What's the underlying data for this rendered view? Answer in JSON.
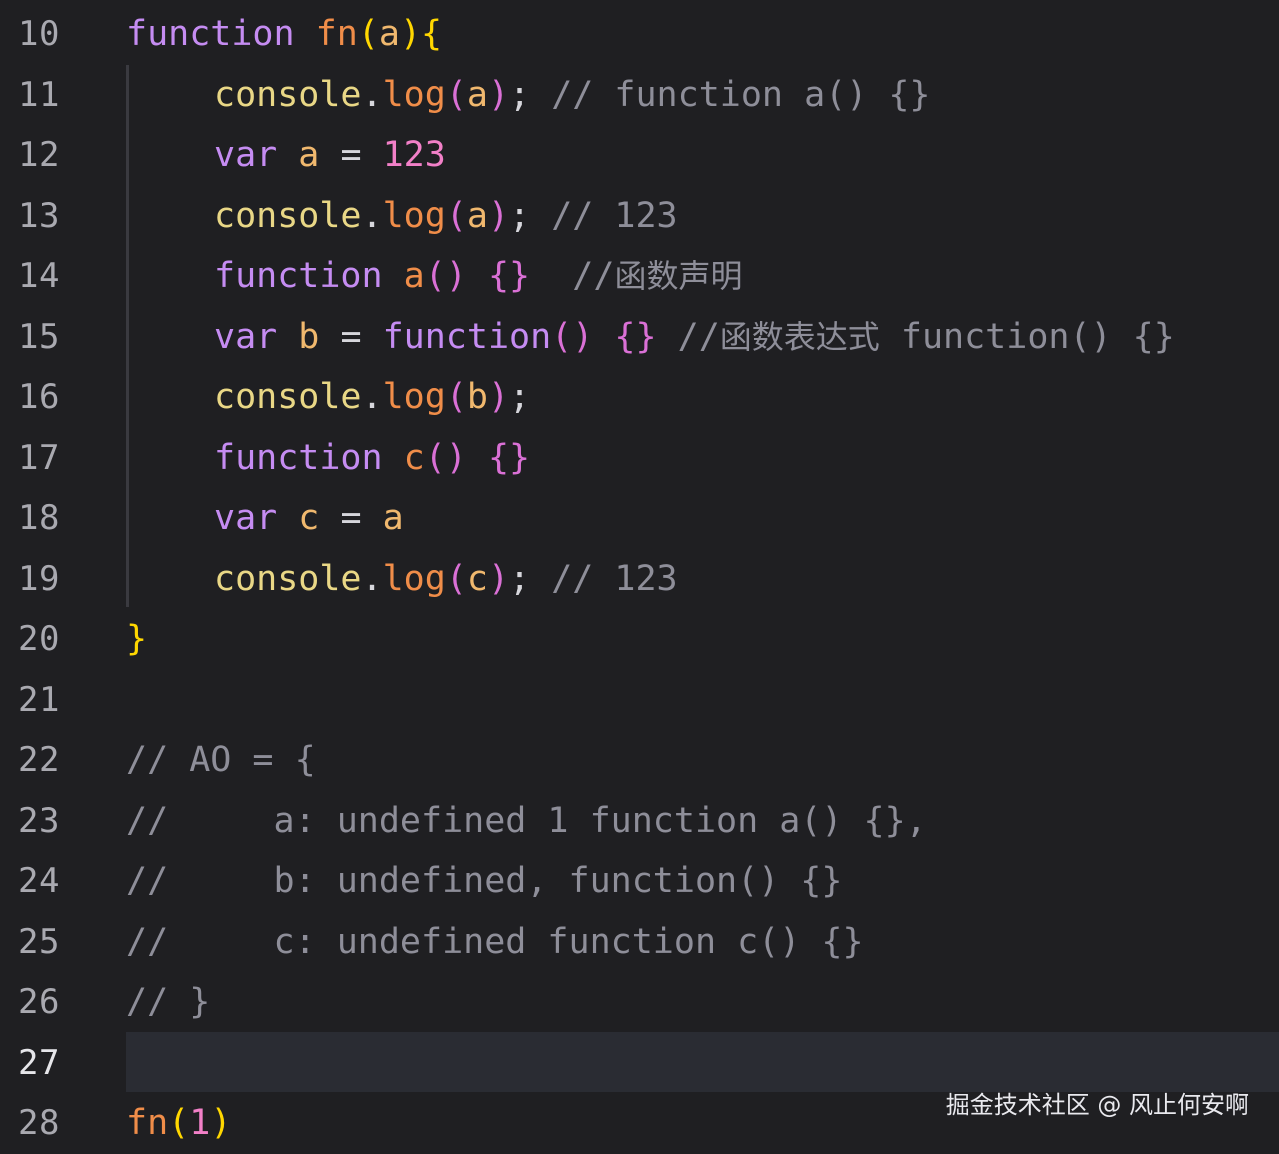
{
  "editor": {
    "lines": [
      {
        "n": "10",
        "parts": [
          [
            "kw",
            "function"
          ],
          [
            "plain",
            " "
          ],
          [
            "fn",
            "fn"
          ],
          [
            "punc-y",
            "("
          ],
          [
            "ident",
            "a"
          ],
          [
            "punc-y",
            ")"
          ],
          [
            "punc-y",
            "{"
          ]
        ]
      },
      {
        "n": "11",
        "indent": 1,
        "parts": [
          [
            "call",
            "console"
          ],
          [
            "op",
            "."
          ],
          [
            "fn",
            "log"
          ],
          [
            "punc-p",
            "("
          ],
          [
            "ident",
            "a"
          ],
          [
            "punc-p",
            ")"
          ],
          [
            "op",
            "; "
          ],
          [
            "cmt",
            "// function a() {}"
          ]
        ]
      },
      {
        "n": "12",
        "indent": 1,
        "parts": [
          [
            "kw",
            "var"
          ],
          [
            "plain",
            " "
          ],
          [
            "ident",
            "a"
          ],
          [
            "op",
            " = "
          ],
          [
            "num",
            "123"
          ]
        ]
      },
      {
        "n": "13",
        "indent": 1,
        "parts": [
          [
            "call",
            "console"
          ],
          [
            "op",
            "."
          ],
          [
            "fn",
            "log"
          ],
          [
            "punc-p",
            "("
          ],
          [
            "ident",
            "a"
          ],
          [
            "punc-p",
            ")"
          ],
          [
            "op",
            "; "
          ],
          [
            "cmt",
            "// 123"
          ]
        ]
      },
      {
        "n": "14",
        "indent": 1,
        "parts": [
          [
            "kw",
            "function"
          ],
          [
            "plain",
            " "
          ],
          [
            "fn",
            "a"
          ],
          [
            "punc-p",
            "()"
          ],
          [
            "plain",
            " "
          ],
          [
            "punc-p",
            "{}"
          ],
          [
            "plain",
            "  "
          ],
          [
            "cmt",
            "//"
          ],
          [
            "cmt cjk",
            "函数声明"
          ]
        ]
      },
      {
        "n": "15",
        "indent": 1,
        "parts": [
          [
            "kw",
            "var"
          ],
          [
            "plain",
            " "
          ],
          [
            "ident",
            "b"
          ],
          [
            "op",
            " = "
          ],
          [
            "kw",
            "function"
          ],
          [
            "punc-p",
            "()"
          ],
          [
            "plain",
            " "
          ],
          [
            "punc-p",
            "{}"
          ],
          [
            "plain",
            " "
          ],
          [
            "cmt",
            "//"
          ],
          [
            "cmt cjk",
            "函数表达式"
          ],
          [
            "cmt",
            " function() {}"
          ]
        ]
      },
      {
        "n": "16",
        "indent": 1,
        "parts": [
          [
            "call",
            "console"
          ],
          [
            "op",
            "."
          ],
          [
            "fn",
            "log"
          ],
          [
            "punc-p",
            "("
          ],
          [
            "ident",
            "b"
          ],
          [
            "punc-p",
            ")"
          ],
          [
            "op",
            ";"
          ]
        ]
      },
      {
        "n": "17",
        "indent": 1,
        "parts": [
          [
            "kw",
            "function"
          ],
          [
            "plain",
            " "
          ],
          [
            "fn",
            "c"
          ],
          [
            "punc-p",
            "()"
          ],
          [
            "plain",
            " "
          ],
          [
            "punc-p",
            "{}"
          ]
        ]
      },
      {
        "n": "18",
        "indent": 1,
        "parts": [
          [
            "kw",
            "var"
          ],
          [
            "plain",
            " "
          ],
          [
            "ident",
            "c"
          ],
          [
            "op",
            " = "
          ],
          [
            "ident",
            "a"
          ]
        ]
      },
      {
        "n": "19",
        "indent": 1,
        "parts": [
          [
            "call",
            "console"
          ],
          [
            "op",
            "."
          ],
          [
            "fn",
            "log"
          ],
          [
            "punc-p",
            "("
          ],
          [
            "ident",
            "c"
          ],
          [
            "punc-p",
            ")"
          ],
          [
            "op",
            "; "
          ],
          [
            "cmt",
            "// 123"
          ]
        ]
      },
      {
        "n": "20",
        "parts": [
          [
            "punc-y",
            "}"
          ]
        ]
      },
      {
        "n": "21",
        "parts": []
      },
      {
        "n": "22",
        "parts": [
          [
            "cmt",
            "// AO = {"
          ]
        ]
      },
      {
        "n": "23",
        "parts": [
          [
            "cmt",
            "//     a: undefined 1 function a() {},"
          ]
        ]
      },
      {
        "n": "24",
        "parts": [
          [
            "cmt",
            "//     b: undefined, function() {}"
          ]
        ]
      },
      {
        "n": "25",
        "parts": [
          [
            "cmt",
            "//     c: undefined function c() {}"
          ]
        ]
      },
      {
        "n": "26",
        "parts": [
          [
            "cmt",
            "// }"
          ]
        ]
      },
      {
        "n": "27",
        "active": true,
        "parts": []
      },
      {
        "n": "28",
        "parts": [
          [
            "fn",
            "fn"
          ],
          [
            "punc-y",
            "("
          ],
          [
            "num",
            "1"
          ],
          [
            "punc-y",
            ")"
          ]
        ]
      }
    ]
  },
  "watermark": "掘金技术社区 @ 风止何安啊"
}
